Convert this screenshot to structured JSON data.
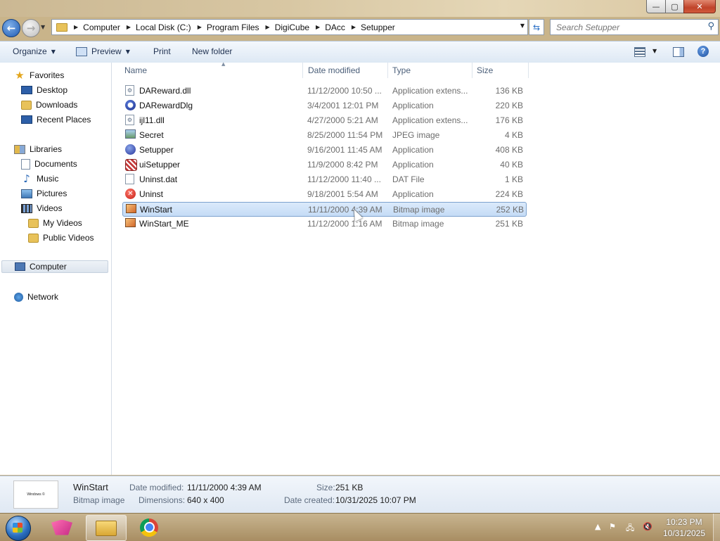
{
  "window": {
    "controls": {
      "minimize": "—",
      "maximize": "▢",
      "close": "✕"
    }
  },
  "address": {
    "breadcrumbs": [
      "Computer",
      "Local Disk (C:)",
      "Program Files",
      "DigiCube",
      "DAcc",
      "Setupper"
    ],
    "search_placeholder": "Search Setupper"
  },
  "toolbar": {
    "organize": "Organize",
    "preview": "Preview",
    "print": "Print",
    "new_folder": "New folder"
  },
  "nav": {
    "favorites": {
      "label": "Favorites",
      "icon": "star-icon"
    },
    "desktop": "Desktop",
    "downloads": "Downloads",
    "recent_places": "Recent Places",
    "libraries": "Libraries",
    "documents": "Documents",
    "music": "Music",
    "pictures": "Pictures",
    "videos": "Videos",
    "my_videos": "My Videos",
    "public_videos": "Public Videos",
    "computer": "Computer",
    "network": "Network"
  },
  "columns": {
    "name": "Name",
    "date": "Date modified",
    "type": "Type",
    "size": "Size"
  },
  "files": [
    {
      "name": "DAReward.dll",
      "date": "11/12/2000 10:50 ...",
      "type": "Application extens...",
      "size": "136 KB",
      "icon": "dll-file-icon"
    },
    {
      "name": "DARewardDlg",
      "date": "3/4/2001 12:01 PM",
      "type": "Application",
      "size": "220 KB",
      "icon": "application-icon"
    },
    {
      "name": "ijl11.dll",
      "date": "4/27/2000 5:21 AM",
      "type": "Application extens...",
      "size": "176 KB",
      "icon": "dll-file-icon"
    },
    {
      "name": "Secret",
      "date": "8/25/2000 11:54 PM",
      "type": "JPEG image",
      "size": "4 KB",
      "icon": "jpeg-file-icon"
    },
    {
      "name": "Setupper",
      "date": "9/16/2001 11:45 AM",
      "type": "Application",
      "size": "408 KB",
      "icon": "setupper-app-icon"
    },
    {
      "name": "uiSetupper",
      "date": "11/9/2000 8:42 PM",
      "type": "Application",
      "size": "40 KB",
      "icon": "ui-setupper-app-icon"
    },
    {
      "name": "Uninst.dat",
      "date": "11/12/2000 11:40 ...",
      "type": "DAT File",
      "size": "1 KB",
      "icon": "dat-file-icon"
    },
    {
      "name": "Uninst",
      "date": "9/18/2001 5:54 AM",
      "type": "Application",
      "size": "224 KB",
      "icon": "uninstall-app-icon"
    },
    {
      "name": "WinStart",
      "date": "11/11/2000 4:39 AM",
      "type": "Bitmap image",
      "size": "252 KB",
      "icon": "bitmap-file-icon",
      "selected": true
    },
    {
      "name": "WinStart_ME",
      "date": "11/12/2000 1:16 AM",
      "type": "Bitmap image",
      "size": "251 KB",
      "icon": "bitmap-file-icon"
    }
  ],
  "details": {
    "name": "WinStart",
    "type": "Bitmap image",
    "date_modified_label": "Date modified:",
    "date_modified": "11/11/2000 4:39 AM",
    "dimensions_label": "Dimensions:",
    "dimensions": "640 x 400",
    "size_label": "Size:",
    "size": "251 KB",
    "date_created_label": "Date created:",
    "date_created": "10/31/2025 10:07 PM",
    "thumbnail_text": "Windows ©\n\n"
  },
  "taskbar": {
    "time": "10:23 PM",
    "date": "10/31/2025"
  }
}
